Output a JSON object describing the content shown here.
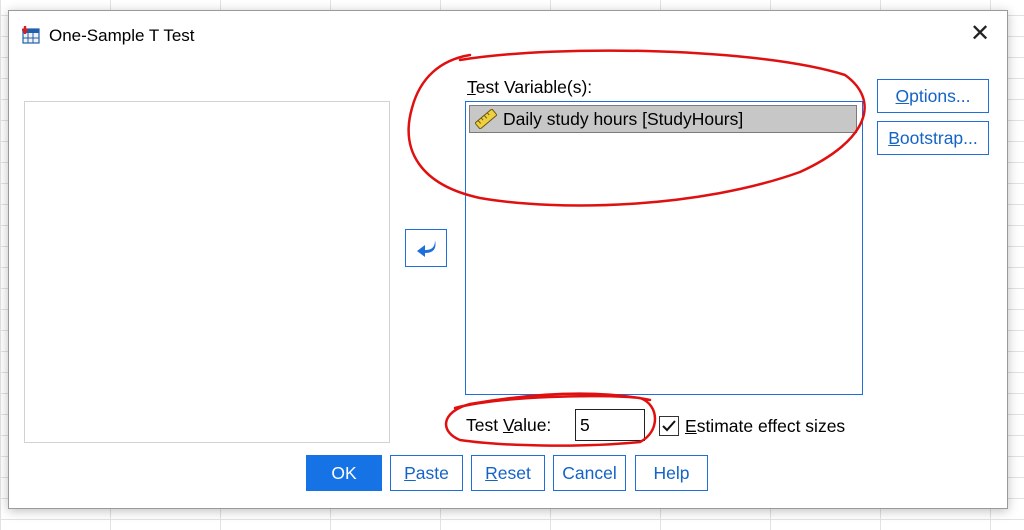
{
  "window": {
    "title": "One-Sample T Test",
    "close_glyph": "✕"
  },
  "target_list": {
    "label_underlined": "T",
    "label_rest": "est Variable(s):",
    "items": [
      {
        "label": "Daily study hours [StudyHours]",
        "icon": "scale-ruler-icon",
        "selected": true
      }
    ]
  },
  "side_buttons": {
    "options_underlined": "O",
    "options_rest": "ptions...",
    "bootstrap_underlined": "B",
    "bootstrap_rest": "ootstrap..."
  },
  "test_value": {
    "label_pre": "Test ",
    "label_underlined": "V",
    "label_post": "alue:",
    "value": "5"
  },
  "effect_sizes": {
    "checked": true,
    "label_underlined": "E",
    "label_rest": "stimate effect sizes"
  },
  "buttons": {
    "ok": "OK",
    "paste_underlined": "P",
    "paste_rest": "aste",
    "reset_underlined": "R",
    "reset_rest": "eset",
    "cancel": "Cancel",
    "help": "Help"
  },
  "colors": {
    "accent": "#1e6fd9",
    "ok_background": "#1673e6",
    "selection": "#c7c7c7",
    "annotation_red": "#e01010"
  }
}
